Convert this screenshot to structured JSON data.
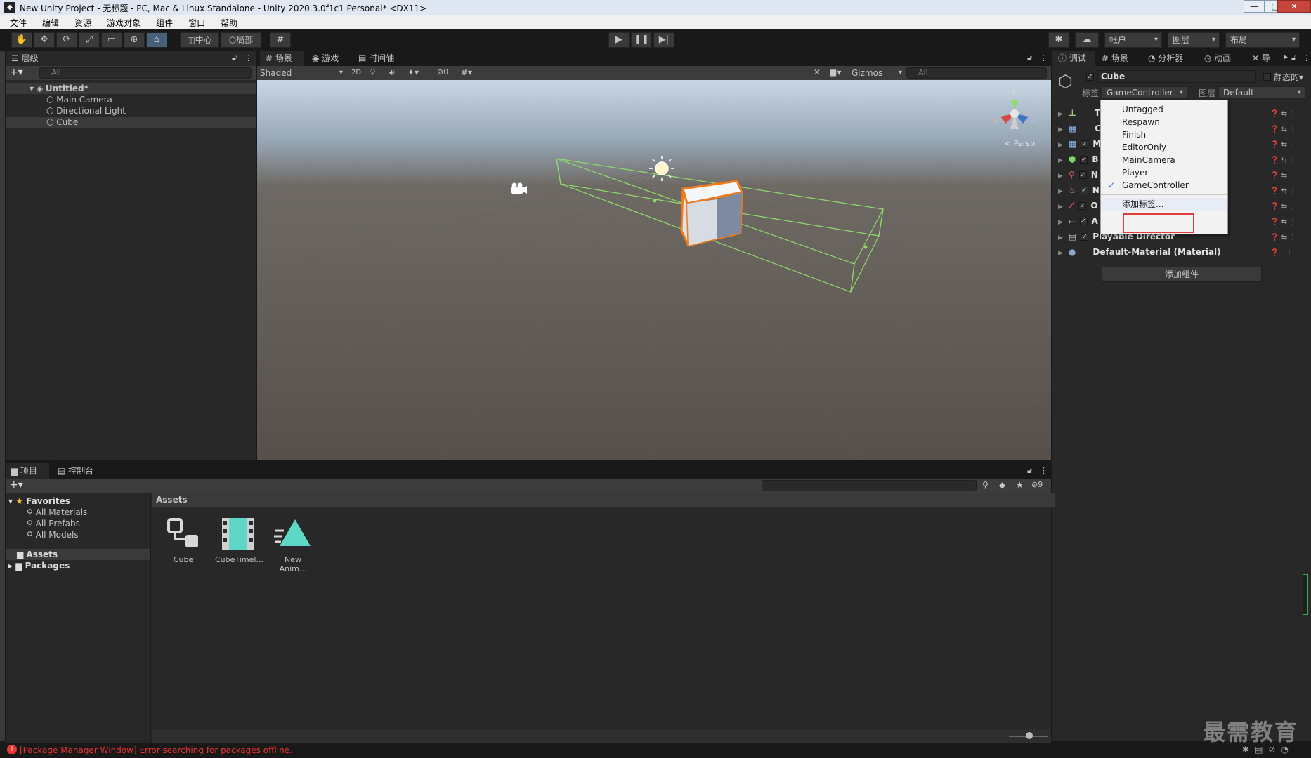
{
  "window": {
    "title": "New Unity Project - 无标题 - PC, Mac & Linux Standalone - Unity 2020.3.0f1c1 Personal* <DX11>",
    "minimize": "—",
    "maximize": "▢",
    "close": "✕"
  },
  "menu": [
    "文件",
    "编辑",
    "资源",
    "游戏对象",
    "组件",
    "窗口",
    "帮助"
  ],
  "toolbar": {
    "center_btn": "中心",
    "local_btn": "局部",
    "account": "帐户",
    "layers": "图层",
    "layout": "布局"
  },
  "hierarchy": {
    "tab": "层级",
    "search_placeholder": "All",
    "scene": "Untitled*",
    "items": [
      "Main Camera",
      "Directional Light",
      "Cube"
    ]
  },
  "scene_view": {
    "tabs": [
      "场景",
      "游戏",
      "时间轴"
    ],
    "shading": "Shaded",
    "mode_2d": "2D",
    "hidden_count": "0",
    "gizmos": "Gizmos",
    "search_placeholder": "All",
    "persp": "Persp",
    "axes": {
      "x": "x",
      "y": "y",
      "z": "z"
    }
  },
  "inspector": {
    "tabs": [
      "调试",
      "场景",
      "分析器",
      "动画",
      "导"
    ],
    "object_name": "Cube",
    "static_label": "静态的",
    "tag_label": "标签",
    "tag_value": "GameController",
    "layer_label": "图层",
    "layer_value": "Default",
    "component_initials": [
      "T",
      "C",
      "M",
      "B",
      "N",
      "N",
      "O",
      "A"
    ],
    "playable_director": "Playable Director",
    "material": "Default-Material (Material)",
    "add_component": "添加组件"
  },
  "tag_menu": {
    "items": [
      "Untagged",
      "Respawn",
      "Finish",
      "EditorOnly",
      "MainCamera",
      "Player",
      "GameController"
    ],
    "checked": "GameController",
    "add_tag": "添加标签..."
  },
  "project": {
    "tabs": [
      "项目",
      "控制台"
    ],
    "favorites": "Favorites",
    "favorite_items": [
      "All Materials",
      "All Prefabs",
      "All Models"
    ],
    "roots": [
      "Assets",
      "Packages"
    ],
    "breadcrumb": "Assets",
    "assets": [
      "Cube",
      "CubeTimel...",
      "New Anim..."
    ],
    "hidden_count": "9"
  },
  "status": {
    "error": "[Package Manager Window] Error searching for packages offline."
  },
  "watermark": "最需教育",
  "colors": {
    "selection_orange": "#f07a1c",
    "bounds_green": "#8fdc6a",
    "highlight_red": "#e23b3b",
    "teal_icon": "#5fd7c6"
  }
}
